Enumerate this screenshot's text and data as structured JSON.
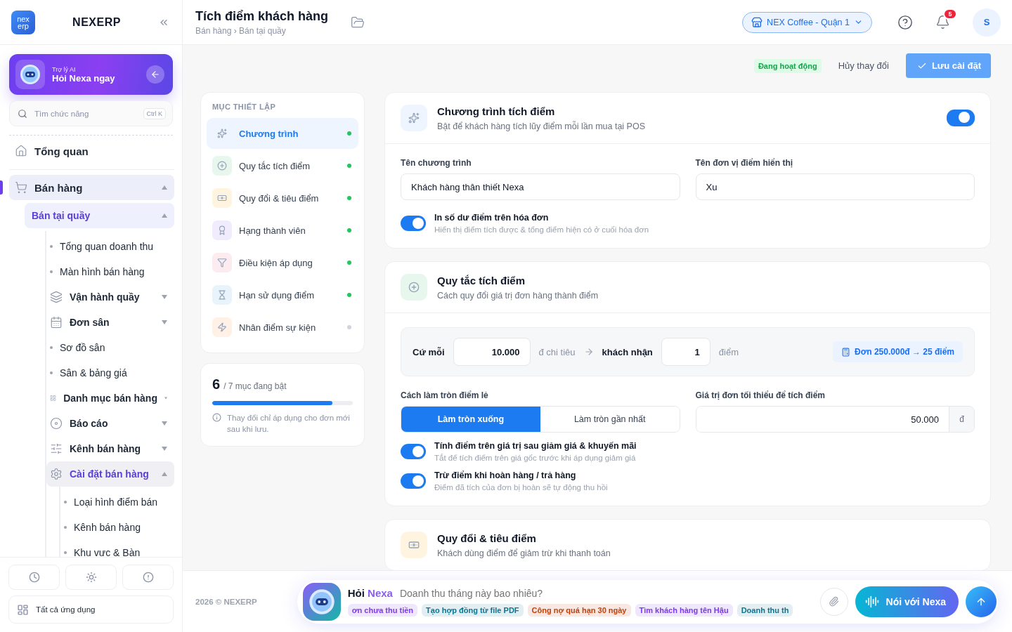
{
  "sidebar": {
    "logo": [
      "nex",
      "erp"
    ],
    "brand": "NEXERP",
    "ai_card": {
      "caption": "Trợ lý AI",
      "title": "Hỏi Nexa ngay"
    },
    "search": {
      "placeholder": "Tìm chức năng",
      "shortcut": "Ctrl K"
    },
    "nav": [
      {
        "label": "Tổng quan",
        "selected": false
      },
      {
        "label": "Bán hàng",
        "selected": true,
        "expanded": true,
        "children": [
          {
            "label": "Bán tại quầy",
            "selected": true,
            "expanded": true,
            "children": [
              {
                "label": "Tổng quan doanh thu",
                "selected": false
              },
              {
                "label": "Màn hình bán hàng",
                "selected": false
              },
              {
                "label": "Vận hành quầy",
                "selected": false,
                "expanded": false
              },
              {
                "label": "Đơn sân",
                "selected": false,
                "expanded": false
              },
              {
                "label": "Sơ đồ sân",
                "selected": false
              },
              {
                "label": "Sân & bảng giá",
                "selected": false
              },
              {
                "label": "Danh mục bán hàng",
                "selected": false,
                "expanded": false
              },
              {
                "label": "Báo cáo",
                "selected": false,
                "expanded": false
              },
              {
                "label": "Kênh bán hàng",
                "selected": false,
                "expanded": false
              },
              {
                "label": "Cài đặt bán hàng",
                "selected": true,
                "expanded": true,
                "children": [
                  {
                    "label": "Loại hình điểm bán",
                    "selected": false
                  },
                  {
                    "label": "Kênh bán hàng",
                    "selected": false
                  },
                  {
                    "label": "Khu vực & Bàn",
                    "selected": false
                  }
                ]
              }
            ]
          }
        ]
      }
    ],
    "all_apps": "Tất cả ứng dụng"
  },
  "header": {
    "title": "Tích điểm khách hàng",
    "breadcrumb": "Bán hàng › Bán tại quầy",
    "store": "NEX Coffee - Quận 1",
    "notifications": "5",
    "avatar": "S"
  },
  "actions": {
    "status": "Đang hoạt động",
    "cancel": "Hủy thay đổi",
    "save": "Lưu cài đặt"
  },
  "settings_menu": {
    "heading": "MỤC THIẾT LẬP",
    "items": [
      {
        "label": "Chương trình",
        "selected": true,
        "enabled": true
      },
      {
        "label": "Quy tắc tích điểm",
        "selected": false,
        "enabled": true
      },
      {
        "label": "Quy đổi & tiêu điểm",
        "selected": false,
        "enabled": true
      },
      {
        "label": "Hạng thành viên",
        "selected": false,
        "enabled": true
      },
      {
        "label": "Điều kiện áp dụng",
        "selected": false,
        "enabled": true
      },
      {
        "label": "Hạn sử dụng điểm",
        "selected": false,
        "enabled": true
      },
      {
        "label": "Nhân điểm sự kiện",
        "selected": false,
        "enabled": false
      }
    ]
  },
  "summary": {
    "count": "6",
    "total": "/ 7 mục đang bật",
    "level": 0.857,
    "note": "Thay đổi chỉ áp dụng cho đơn mới sau khi lưu."
  },
  "program_card": {
    "title": "Chương trình tích điểm",
    "subtitle": "Bật để khách hàng tích lũy điểm mỗi lần mua tại POS",
    "on": true,
    "fields": [
      {
        "label": "Tên chương trình",
        "value": "Khách hàng thân thiết Nexa"
      },
      {
        "label": "Tên đơn vị điểm hiển thị",
        "value": "Xu"
      }
    ],
    "toggles": [
      {
        "title": "In số dư điểm trên hóa đơn",
        "description": "Hiển thị điểm tích được & tổng điểm hiện có ở cuối hóa đơn",
        "on": true
      }
    ]
  },
  "rules_card": {
    "title": "Quy tắc tích điểm",
    "subtitle": "Cách quy đổi giá trị đơn hàng thành điểm",
    "rule": {
      "prefix": "Cứ mỗi",
      "amount": "10.000",
      "spend": "đ chi tiêu",
      "receive": "khách nhận",
      "points": "1",
      "unit": "điểm",
      "example": "Đơn 250.000đ → 25 điểm"
    },
    "rounding": {
      "label": "Cách làm tròn điểm lẻ",
      "options": [
        {
          "label": "Làm tròn xuống",
          "selected": true
        },
        {
          "label": "Làm tròn gần nhất",
          "selected": false
        }
      ]
    },
    "minimum": {
      "label": "Giá trị đơn tối thiểu để tích điểm",
      "value": "50.000",
      "suffix": "đ"
    },
    "toggles": [
      {
        "title": "Tính điểm trên giá trị sau giảm giá & khuyến mãi",
        "description": "Tắt để tích điểm trên giá gốc trước khi áp dụng giảm giá",
        "on": true
      },
      {
        "title": "Trừ điểm khi hoàn hàng / trả hàng",
        "description": "Điểm đã tích của đơn bị hoàn sẽ tự động thu hồi",
        "on": true
      }
    ]
  },
  "redeem_card": {
    "title": "Quy đổi & tiêu điểm",
    "subtitle": "Khách dùng điểm để giảm trừ khi thanh toán"
  },
  "footer": {
    "copyright": "2026 © NEXERP",
    "assistant": {
      "ask": "Hỏi",
      "name": "Nexa",
      "placeholder": "Doanh thu tháng này bao nhiêu?",
      "chips": [
        {
          "label": "ơn chưa thu tiền",
          "color": "#7c3aed"
        },
        {
          "label": "Tạo hợp đồng từ file PDF",
          "color": "#0e7490"
        },
        {
          "label": "Công nợ quá hạn 30 ngày",
          "color": "#c2410c"
        },
        {
          "label": "Tìm khách hàng tên Hậu",
          "color": "#7c3aed"
        },
        {
          "label": "Doanh thu th",
          "color": "#0e7490"
        }
      ],
      "talk": "Nói với Nexa"
    }
  }
}
